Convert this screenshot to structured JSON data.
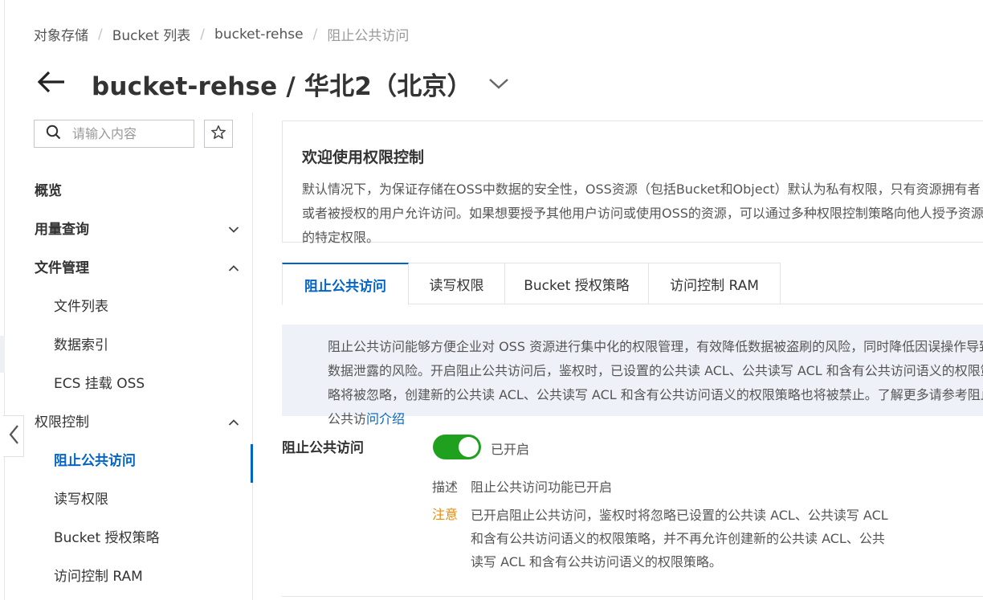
{
  "breadcrumb": {
    "items": [
      "对象存储",
      "Bucket 列表",
      "bucket-rehse"
    ],
    "current": "阻止公共访问",
    "separator": "/"
  },
  "header": {
    "title": "bucket-rehse / 华北2（北京）"
  },
  "sidebar": {
    "search_placeholder": "请输入内容",
    "items": [
      {
        "label": "概览"
      },
      {
        "label": "用量查询"
      },
      {
        "label": "文件管理"
      },
      {
        "label": "文件列表"
      },
      {
        "label": "数据索引"
      },
      {
        "label": "ECS 挂载 OSS"
      },
      {
        "label": "权限控制"
      },
      {
        "label": "阻止公共访问"
      },
      {
        "label": "读写权限"
      },
      {
        "label": "Bucket 授权策略"
      },
      {
        "label": "访问控制 RAM"
      }
    ]
  },
  "welcome": {
    "title": "欢迎使用权限控制",
    "text": "默认情况下，为保证存储在OSS中数据的安全性，OSS资源（包括Bucket和Object）默认为私有权限，只有资源拥有者或者被授权的用户允许访问。如果想要授予其他用户访问或使用OSS的资源，可以通过多种权限控制策略向他人授予资源的特定权限。"
  },
  "tabs": [
    {
      "label": "阻止公共访问"
    },
    {
      "label": "读写权限"
    },
    {
      "label": "Bucket 授权策略"
    },
    {
      "label": "访问控制 RAM"
    }
  ],
  "notice": {
    "text": "阻止公共访问能够方便企业对 OSS 资源进行集中化的权限管理，有效降低数据被盗刷的风险，同时降低因误操作导致数据泄露的风险。开启阻止公共访问后，鉴权时，已设置的公共读 ACL、公共读写 ACL 和含有公共访问语义的权限策略将被忽略，创建新的公共读 ACL、公共读写 ACL 和含有公共访问语义的权限策略也将被禁止。了解更多请参考阻止公共访",
    "link": "问介绍"
  },
  "setting": {
    "label": "阻止公共访问",
    "state": "已开启",
    "enabled": true,
    "desc_key": "描述",
    "desc_value": "阻止公共访问功能已开启",
    "note_key": "注意",
    "note_value": "已开启阻止公共访问，鉴权时将忽略已设置的公共读 ACL、公共读写 ACL 和含有公共访问语义的权限策略，并不再允许创建新的公共读 ACL、公共读写 ACL 和含有公共访问语义的权限策略。"
  },
  "colors": {
    "accent": "#0064c8",
    "switch_on": "#20a01f",
    "warning": "#e98b0b",
    "notice_bg": "#eef1f7"
  }
}
